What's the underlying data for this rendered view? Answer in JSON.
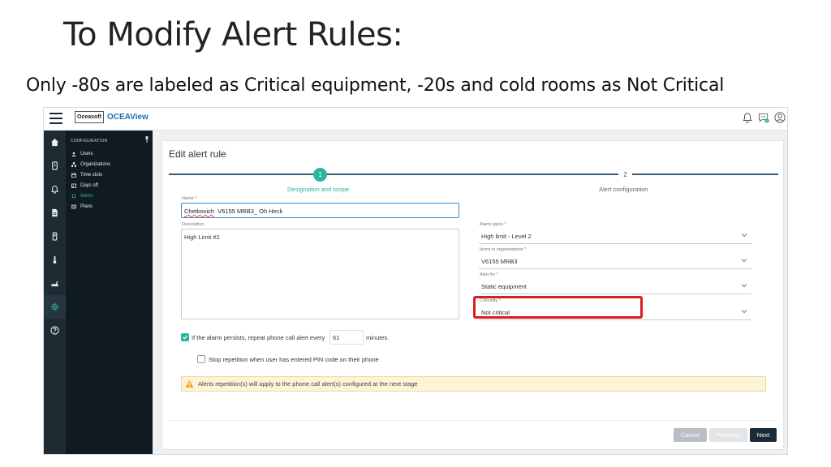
{
  "slide": {
    "title": "To Modify Alert Rules:",
    "subtitle": "Only -80s are labeled as Critical equipment, -20s and cold rooms as Not Critical"
  },
  "app": {
    "brand_box": "Oceasoft",
    "brand_name": "OCEAView",
    "accent_color": "#2bb5a0",
    "sidebar_color": "#1f2b33"
  },
  "topbar": {
    "icons": [
      "bell-icon",
      "chat-icon",
      "user-icon"
    ],
    "notification_badge": "1"
  },
  "nav_rail": {
    "icons": [
      "home-icon",
      "sensor-icon",
      "bell-icon",
      "report-icon",
      "device-icon",
      "thermometer-icon",
      "network-icon",
      "settings-icon",
      "help-icon"
    ]
  },
  "config_panel": {
    "header": "CONFIGURATION",
    "items": [
      {
        "label": "Users",
        "icon": "user-icon"
      },
      {
        "label": "Organizations",
        "icon": "org-icon"
      },
      {
        "label": "Time slots",
        "icon": "calendar-icon"
      },
      {
        "label": "Days off",
        "icon": "calendar-off-icon"
      },
      {
        "label": "Alerts",
        "icon": "bell-icon",
        "active": true
      },
      {
        "label": "Plans",
        "icon": "plan-icon"
      }
    ]
  },
  "card": {
    "title": "Edit alert rule",
    "steps": [
      {
        "number": "1",
        "label": "Designation and scope"
      },
      {
        "number": "2",
        "label": "Alert configuration"
      }
    ],
    "name_label": "Name *",
    "name_value_prefix": "Chetkovich",
    "name_value_rest": "  V6155 MRB3_ Oh Heck",
    "description_label": "Description",
    "description_value": "High Limit #2",
    "alarm_types_label": "Alarm types *",
    "alarm_types_value": "High limit - Level 2",
    "items_label": "Items in organizations *",
    "items_value": "V6155 MRB3",
    "alert_for_label": "Alert for *",
    "alert_for_value": "Static equipment",
    "criticality_label": "Criticality *",
    "criticality_value": "Not critical",
    "repeat_text": "If the alarm persists, repeat phone call alert every",
    "repeat_minutes": "61",
    "minutes_label": "minutes.",
    "stop_text": "Stop repetition when user has entered PIN code on their phone",
    "warning_text": "Alerts repetition(s) will apply to the phone call alert(s) configured at the next stage",
    "buttons": {
      "cancel": "Cancel",
      "previous": "Previous",
      "next": "Next"
    }
  }
}
